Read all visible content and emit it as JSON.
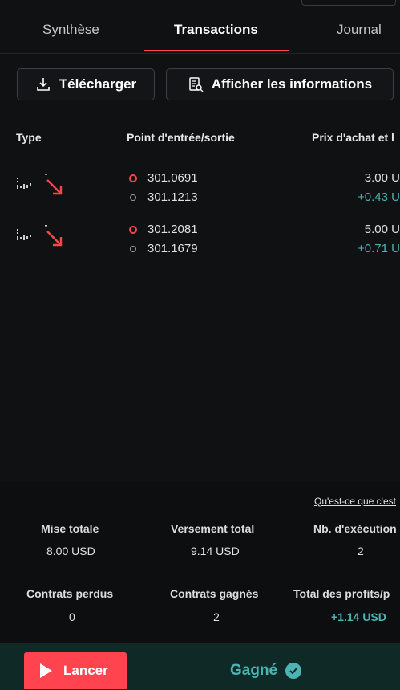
{
  "tabs": [
    {
      "label": "Synthèse"
    },
    {
      "label": "Transactions"
    },
    {
      "label": "Journal"
    }
  ],
  "toolbar": {
    "download_label": "Télécharger",
    "info_label": "Afficher les informations"
  },
  "table": {
    "headers": [
      "Type",
      "Point d'entrée/sortie",
      "Prix d'achat et l"
    ],
    "rows": [
      {
        "entry": "301.0691",
        "exit": "301.1213",
        "buy": "3.00 U",
        "profit": "+0.43 U"
      },
      {
        "entry": "301.2081",
        "exit": "301.1679",
        "buy": "5.00 U",
        "profit": "+0.71 U"
      }
    ]
  },
  "summary": {
    "help_link": "Qu'est-ce que c'est",
    "total_stake_label": "Mise totale",
    "total_stake": "8.00 USD",
    "total_payout_label": "Versement total",
    "total_payout": "9.14 USD",
    "runs_label": "Nb. d'exécution",
    "runs": "2",
    "lost_label": "Contrats perdus",
    "lost": "0",
    "won_label": "Contrats gagnés",
    "won": "2",
    "profit_label": "Total des profits/p",
    "profit": "+1.14 USD"
  },
  "bottom": {
    "launch_label": "Lancer",
    "status_label": "Gagné"
  },
  "colors": {
    "accent_red": "#ff444f",
    "profit_green": "#4bb4b3"
  },
  "icons": {
    "download": "download-icon",
    "info": "info-document-icon",
    "type": "trade-type-icon",
    "arrow": "arrow-down-right-icon",
    "play": "play-icon",
    "check": "check-icon"
  }
}
